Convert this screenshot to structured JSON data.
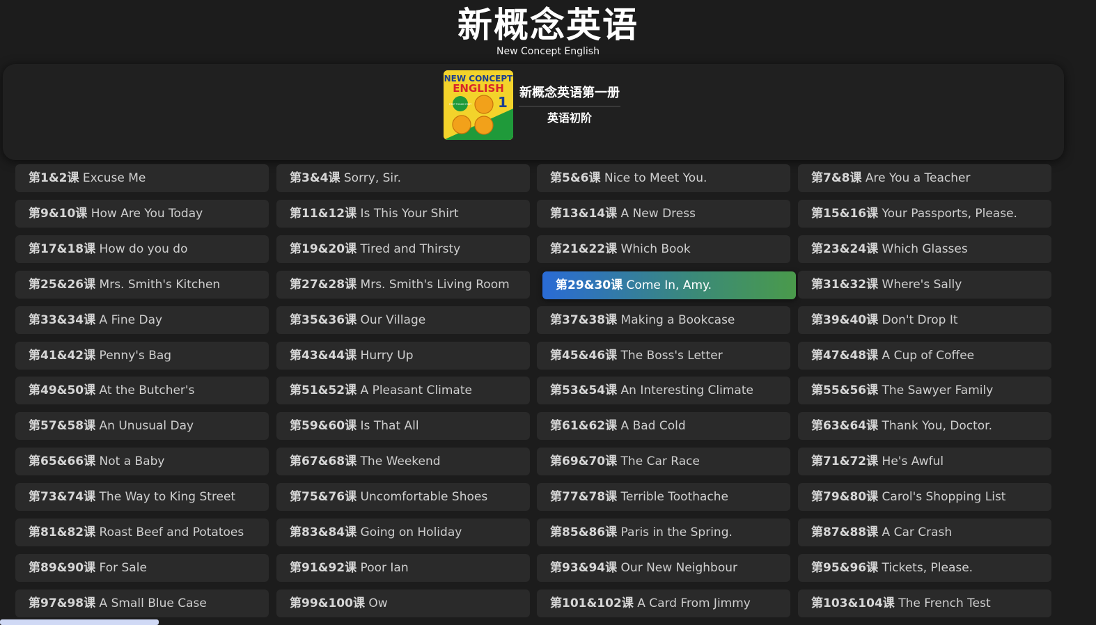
{
  "header": {
    "title": "新概念英语",
    "subtitle": "New Concept English"
  },
  "book": {
    "title": "新概念英语第一册",
    "level": "英语初阶",
    "cover": {
      "line1": "NEW CONCEPT",
      "line2": "ENGLISH",
      "number": "1",
      "badge": "FIRST THINGS FIRST",
      "colors": {
        "yellow": "#f3d32b",
        "green": "#1f9a3a",
        "red": "#d8252a",
        "blue": "#1c3f8f",
        "ball": "#f2a11a"
      }
    }
  },
  "active_lesson_index": 15,
  "lessons": [
    {
      "num": "第1&2课",
      "title": "Excuse Me"
    },
    {
      "num": "第3&4课",
      "title": "Sorry, Sir."
    },
    {
      "num": "第5&6课",
      "title": "Nice to Meet You."
    },
    {
      "num": "第7&8课",
      "title": "Are You a Teacher"
    },
    {
      "num": "第9&10课",
      "title": "How Are You Today"
    },
    {
      "num": "第11&12课",
      "title": "Is This Your Shirt"
    },
    {
      "num": "第13&14课",
      "title": "A New Dress"
    },
    {
      "num": "第15&16课",
      "title": "Your Passports, Please."
    },
    {
      "num": "第17&18课",
      "title": "How do you do"
    },
    {
      "num": "第19&20课",
      "title": "Tired and Thirsty"
    },
    {
      "num": "第21&22课",
      "title": "Which Book"
    },
    {
      "num": "第23&24课",
      "title": "Which Glasses"
    },
    {
      "num": "第25&26课",
      "title": "Mrs. Smith's Kitchen"
    },
    {
      "num": "第27&28课",
      "title": "Mrs. Smith's Living Room"
    },
    {
      "num": "第29&30课",
      "title": "Come In, Amy."
    },
    {
      "num": "第31&32课",
      "title": "Where's Sally"
    },
    {
      "num": "第33&34课",
      "title": "A Fine Day"
    },
    {
      "num": "第35&36课",
      "title": "Our Village"
    },
    {
      "num": "第37&38课",
      "title": "Making a Bookcase"
    },
    {
      "num": "第39&40课",
      "title": "Don't Drop It"
    },
    {
      "num": "第41&42课",
      "title": "Penny's Bag"
    },
    {
      "num": "第43&44课",
      "title": "Hurry Up"
    },
    {
      "num": "第45&46课",
      "title": "The Boss's Letter"
    },
    {
      "num": "第47&48课",
      "title": "A Cup of Coffee"
    },
    {
      "num": "第49&50课",
      "title": "At the Butcher's"
    },
    {
      "num": "第51&52课",
      "title": "A Pleasant Climate"
    },
    {
      "num": "第53&54课",
      "title": "An Interesting Climate"
    },
    {
      "num": "第55&56课",
      "title": "The Sawyer Family"
    },
    {
      "num": "第57&58课",
      "title": "An Unusual Day"
    },
    {
      "num": "第59&60课",
      "title": "Is That All"
    },
    {
      "num": "第61&62课",
      "title": "A Bad Cold"
    },
    {
      "num": "第63&64课",
      "title": "Thank You, Doctor."
    },
    {
      "num": "第65&66课",
      "title": "Not a Baby"
    },
    {
      "num": "第67&68课",
      "title": "The Weekend"
    },
    {
      "num": "第69&70课",
      "title": "The Car Race"
    },
    {
      "num": "第71&72课",
      "title": "He's Awful"
    },
    {
      "num": "第73&74课",
      "title": "The Way to King Street"
    },
    {
      "num": "第75&76课",
      "title": "Uncomfortable Shoes"
    },
    {
      "num": "第77&78课",
      "title": "Terrible Toothache"
    },
    {
      "num": "第79&80课",
      "title": "Carol's Shopping List"
    },
    {
      "num": "第81&82课",
      "title": "Roast Beef and Potatoes"
    },
    {
      "num": "第83&84课",
      "title": "Going on Holiday"
    },
    {
      "num": "第85&86课",
      "title": "Paris in the Spring."
    },
    {
      "num": "第87&88课",
      "title": "A Car Crash"
    },
    {
      "num": "第89&90课",
      "title": "For Sale"
    },
    {
      "num": "第91&92课",
      "title": "Poor Ian"
    },
    {
      "num": "第93&94课",
      "title": "Our New Neighbour"
    },
    {
      "num": "第95&96课",
      "title": "Tickets, Please."
    },
    {
      "num": "第97&98课",
      "title": "A Small Blue Case"
    },
    {
      "num": "第99&100课",
      "title": "Ow"
    },
    {
      "num": "第101&102课",
      "title": "A Card From Jimmy"
    },
    {
      "num": "第103&104课",
      "title": "The French Test"
    }
  ],
  "colors": {
    "background": "#1c1c1c",
    "card": "#2a2a2a",
    "active_gradient_start": "#2a6bd6",
    "active_gradient_end": "#4a9a4b"
  }
}
